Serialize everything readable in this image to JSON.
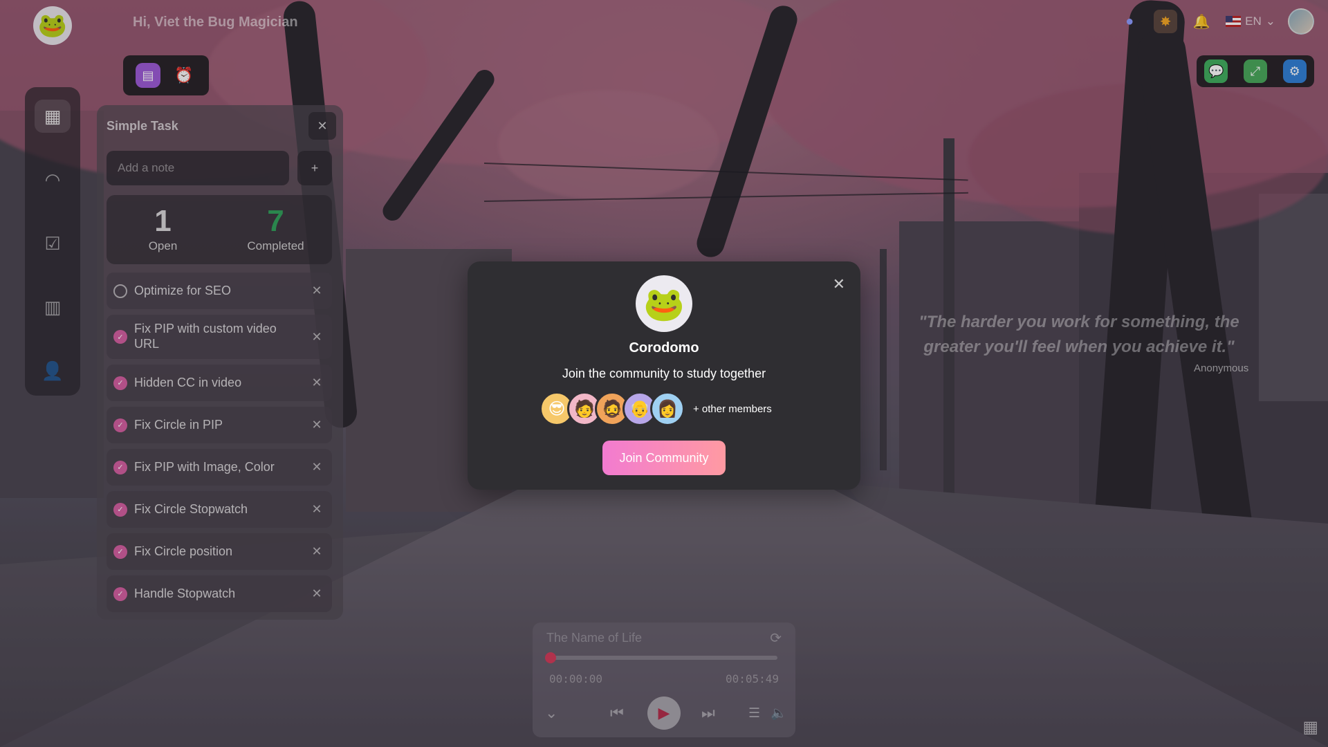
{
  "header": {
    "greeting": "Hi, Viet the Bug Magician",
    "language": "EN"
  },
  "task_panel": {
    "title": "Simple Task",
    "note_placeholder": "Add a note",
    "add_label": "+",
    "close_label": "✕",
    "stats": {
      "open_count": "1",
      "open_label": "Open",
      "completed_count": "7",
      "completed_label": "Completed"
    },
    "tasks": [
      {
        "text": "Optimize for SEO",
        "done": false
      },
      {
        "text": "Fix PIP with custom video URL",
        "done": true
      },
      {
        "text": "Hidden CC in video",
        "done": true
      },
      {
        "text": "Fix Circle in PIP",
        "done": true
      },
      {
        "text": "Fix PIP with Image, Color",
        "done": true
      },
      {
        "text": "Fix Circle Stopwatch",
        "done": true
      },
      {
        "text": "Fix Circle position",
        "done": true
      },
      {
        "text": "Handle Stopwatch",
        "done": true
      }
    ]
  },
  "quote": {
    "text": "\"The harder you work for something, the greater you'll feel when you achieve it.\"",
    "author": "Anonymous"
  },
  "player": {
    "track": "The Name of Life",
    "elapsed": "00:00:00",
    "duration": "00:05:49",
    "progress_fraction": 0.0
  },
  "modal": {
    "title": "Corodomo",
    "subtitle": "Join the community to study together",
    "members_more": "+ other members",
    "join_label": "Join Community",
    "close_label": "✕"
  },
  "colors": {
    "accent_pink": "#d45fa0",
    "completed_green": "#2fa05a",
    "progress_red": "#d23a58",
    "modal_bg": "#2f2e32"
  },
  "icons": {
    "rail": [
      "dashboard-icon",
      "gauge-icon",
      "checklist-icon",
      "chart-icon",
      "user-settings-icon"
    ],
    "top_right": [
      "discord-icon",
      "cookie-icon",
      "bell-icon",
      "flag-us-icon"
    ],
    "right_toolbar": [
      "chat-icon",
      "fullscreen-icon",
      "gear-icon"
    ],
    "mini_toolbar": [
      "notes-icon",
      "alarm-clock-icon"
    ]
  }
}
